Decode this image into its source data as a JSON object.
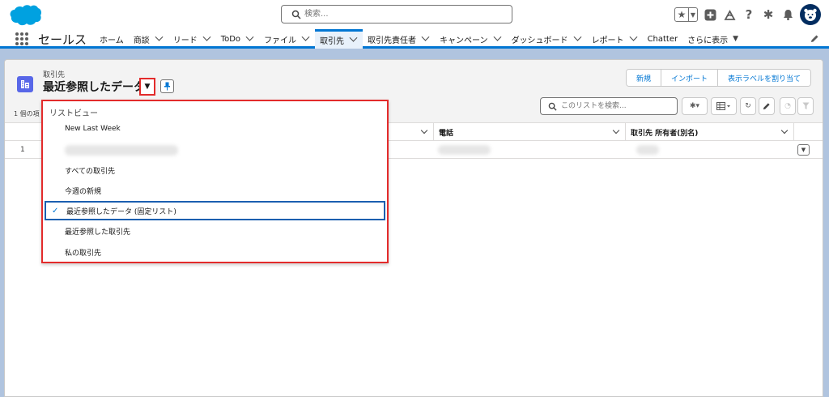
{
  "header": {
    "search_placeholder": "検索...",
    "icons": [
      "favorites-star-icon",
      "favorites-menu-icon",
      "add-icon",
      "trailhead-icon",
      "help-icon",
      "setup-gear-icon",
      "notifications-bell-icon",
      "avatar-icon"
    ]
  },
  "nav": {
    "app_name": "セールス",
    "items": [
      {
        "label": "ホーム",
        "has_menu": false
      },
      {
        "label": "商談",
        "has_menu": true
      },
      {
        "label": "リード",
        "has_menu": true
      },
      {
        "label": "ToDo",
        "has_menu": true
      },
      {
        "label": "ファイル",
        "has_menu": true
      },
      {
        "label": "取引先",
        "has_menu": true,
        "active": true
      },
      {
        "label": "取引先責任者",
        "has_menu": true
      },
      {
        "label": "キャンペーン",
        "has_menu": true
      },
      {
        "label": "ダッシュボード",
        "has_menu": true
      },
      {
        "label": "レポート",
        "has_menu": true
      },
      {
        "label": "Chatter",
        "has_menu": false
      },
      {
        "label": "さらに表示",
        "has_menu": true
      }
    ]
  },
  "list_view": {
    "object_label": "取引先",
    "title": "最近参照したデータ",
    "buttons": {
      "new": "新規",
      "import": "インポート",
      "assign_labels": "表示ラベルを割り当て"
    },
    "item_count": "1 個の項",
    "search_placeholder": "このリストを検索...",
    "columns": [
      "電話",
      "取引先 所有者(別名)"
    ],
    "rows": [
      {
        "num": "1"
      }
    ]
  },
  "dropdown": {
    "header": "リストビュー",
    "items": [
      {
        "label": "New Last Week"
      },
      {
        "label": ""
      },
      {
        "label": "すべての取引先"
      },
      {
        "label": "今週の新規"
      },
      {
        "label": "最近参照したデータ (固定リスト)",
        "selected": true
      },
      {
        "label": "最近参照した取引先"
      },
      {
        "label": "私の取引先"
      }
    ]
  },
  "colors": {
    "brand": "#0176d3",
    "highlight": "#e32b2b",
    "object_icon": "#5867e8",
    "background": "#b0c4df"
  }
}
